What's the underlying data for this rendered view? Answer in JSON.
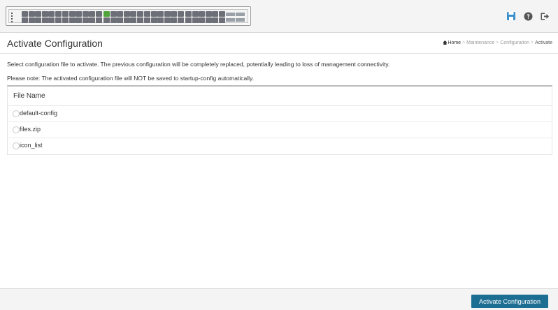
{
  "header": {
    "icons": {
      "save": "save-icon",
      "help": "help-icon",
      "logout": "logout-icon"
    },
    "colors": {
      "save_icon": "#3a8ec9",
      "help_icon": "#555555",
      "logout_icon": "#555555",
      "port_active": "#4fa53a",
      "port_inactive": "#6c6f77"
    }
  },
  "page": {
    "title": "Activate Configuration"
  },
  "breadcrumb": {
    "items": [
      "Home",
      "Maintenance",
      "Configuration",
      "Activate"
    ],
    "separator": ">"
  },
  "messages": {
    "line1": "Select configuration file to activate. The previous configuration will be completely replaced, potentially leading to loss of management connectivity.",
    "line2": "Please note: The activated configuration file will NOT be saved to startup-config automatically."
  },
  "table": {
    "column_header": "File Name",
    "files": [
      "default-config",
      "files.zip",
      "icon_list"
    ]
  },
  "footer": {
    "activate_label": "Activate Configuration",
    "button_color": "#1d6e93"
  }
}
